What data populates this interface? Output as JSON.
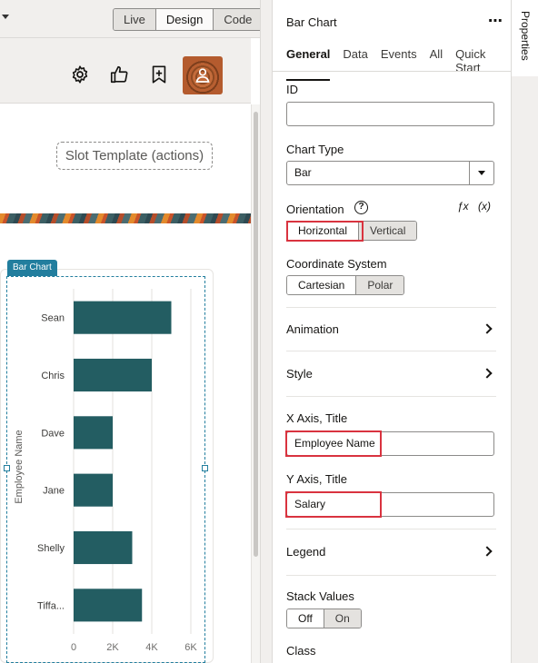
{
  "toolbar": {
    "modes": [
      {
        "label": "Live",
        "active": false
      },
      {
        "label": "Design",
        "active": true
      },
      {
        "label": "Code",
        "active": false
      }
    ]
  },
  "page": {
    "action_icons": [
      "gear-icon",
      "thumbs-up-icon",
      "bookmark-plus-icon",
      "user-avatar-icon"
    ],
    "slot_template": "Slot Template (actions)",
    "chart_tag": "Bar Chart",
    "accent_color": "#227e9e",
    "bar_color": "#235d62"
  },
  "chart_data": {
    "type": "bar",
    "orientation": "horizontal",
    "categories": [
      "Sean",
      "Chris",
      "Dave",
      "Jane",
      "Shelly",
      "Tiffa..."
    ],
    "values": [
      5000,
      4000,
      2000,
      2000,
      3000,
      3500
    ],
    "ylabel": "Employee Name",
    "xlabel": "",
    "xlim": [
      0,
      6000
    ],
    "xticks": [
      "0",
      "2K",
      "4K",
      "6K"
    ],
    "grid": true
  },
  "properties": {
    "panel_title": "Bar Chart",
    "more_label": "⋯",
    "rail_label": "Properties",
    "tabs": [
      {
        "label": "General",
        "active": true
      },
      {
        "label": "Data",
        "active": false
      },
      {
        "label": "Events",
        "active": false
      },
      {
        "label": "All",
        "active": false
      },
      {
        "label": "Quick Start",
        "active": false
      }
    ],
    "id_label": "ID",
    "id_value": "",
    "chart_type_label": "Chart Type",
    "chart_type_value": "Bar",
    "orientation_label": "Orientation",
    "help_glyph": "?",
    "fx_label": "ƒx",
    "x_label": "(x)",
    "orientation_options": [
      {
        "label": "Horizontal",
        "active": true
      },
      {
        "label": "Vertical",
        "active": false
      }
    ],
    "coord_label": "Coordinate System",
    "coord_options": [
      {
        "label": "Cartesian",
        "active": true
      },
      {
        "label": "Polar",
        "active": false
      }
    ],
    "animation_label": "Animation",
    "style_label": "Style",
    "x_axis_title_label": "X Axis, Title",
    "x_axis_title_value": "Employee Name",
    "y_axis_title_label": "Y Axis, Title",
    "y_axis_title_value": "Salary",
    "legend_label": "Legend",
    "stack_label": "Stack Values",
    "stack_options": [
      {
        "label": "Off",
        "active": true
      },
      {
        "label": "On",
        "active": false
      }
    ],
    "class_label": "Class",
    "highlight_color": "#d9333f"
  }
}
